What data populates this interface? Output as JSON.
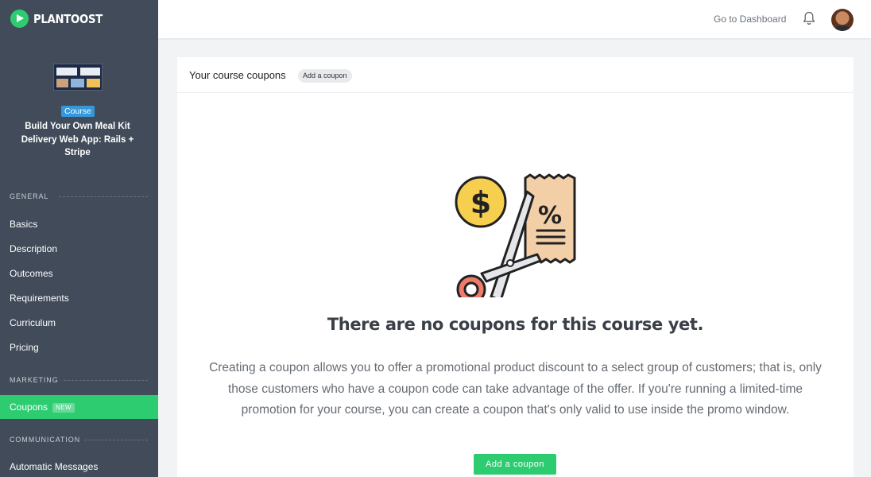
{
  "brand": {
    "name": "PLANTOOST",
    "accent": "#2ecc71"
  },
  "sidebar": {
    "course_badge": "Course",
    "course_title": "Build Your Own Meal Kit Delivery Web App: Rails + Stripe",
    "sections": [
      {
        "label": "GENERAL",
        "items": [
          "Basics",
          "Description",
          "Outcomes",
          "Requirements",
          "Curriculum",
          "Pricing"
        ]
      },
      {
        "label": "MARKETING",
        "items": [
          "Coupons"
        ],
        "active": "Coupons",
        "badge": "NEW"
      },
      {
        "label": "COMMUNICATION",
        "items": [
          "Automatic Messages"
        ]
      }
    ],
    "background": "#414b59"
  },
  "header": {
    "dashboard_link": "Go to Dashboard",
    "icons": [
      "bell-icon",
      "avatar"
    ]
  },
  "card": {
    "title": "Your course coupons",
    "add_chip": "Add a coupon",
    "empty_title": "There are no coupons for this course yet.",
    "empty_description": "Creating a coupon allows you to offer a promotional product discount to a select group of customers; that is, only those customers who have a coupon code can take advantage of the offer. If you're running a limited-time promotion for your course, you can create a coupon that's only valid to use inside the promo window.",
    "cta_label": "Add a coupon",
    "illustration": "coupon-scissors-icon"
  }
}
